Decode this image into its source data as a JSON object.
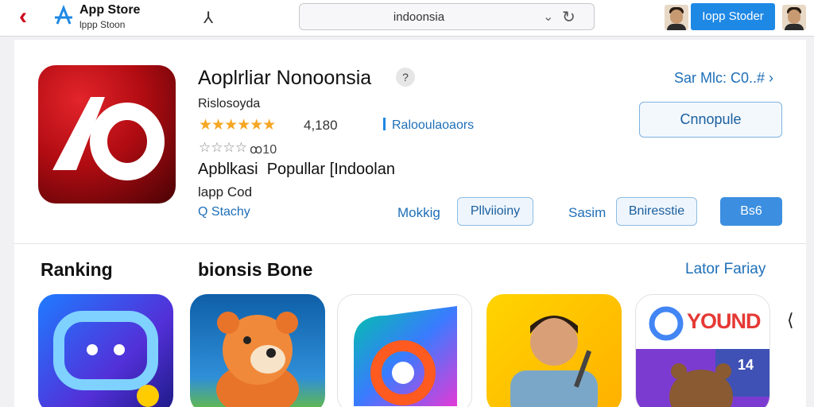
{
  "header": {
    "store_name": "App Store",
    "store_sub": "lppp Stoon",
    "search_text": "indoonsia",
    "store_button": "Iopp Stoder"
  },
  "app": {
    "title": "Aoplrliar Nonoonsia",
    "developer": "Rislosoyda",
    "rating": "★★★★★★",
    "rating_count": "4,180",
    "category": "Ralooulaoaors",
    "rating_secondary": "☆☆☆☆",
    "rating_secondary_count": "ꝏ10",
    "description": "Apblkasi  Popullar [Indoolan",
    "subtitle": "lapp Cod",
    "search_link": "Q Stachy",
    "see_all": "Sar Mlc: C0..# ›",
    "primary_button": "Cnnopule",
    "link_1": "Mokkig",
    "pill_1": "Pllviioiny",
    "link_2": "Sasim",
    "pill_2": "Bniresstie",
    "pill_solid": "Bs6"
  },
  "sections": {
    "ranking": "Ranking",
    "second": "bionsis Bone",
    "link": "Lator Fariay"
  },
  "tiles": {
    "tile_5_text": "YOUND",
    "tile_5_badge": "14"
  },
  "colors": {
    "accent_blue": "#1e88e5",
    "link_blue": "#1e6fb8",
    "app_red": "#b10c12",
    "star_gold": "#f5a623"
  },
  "icons": [
    "back-chevron-icon",
    "app-store-logo-icon",
    "glyph-icon",
    "chevron-down-icon",
    "refresh-icon",
    "help-icon"
  ]
}
